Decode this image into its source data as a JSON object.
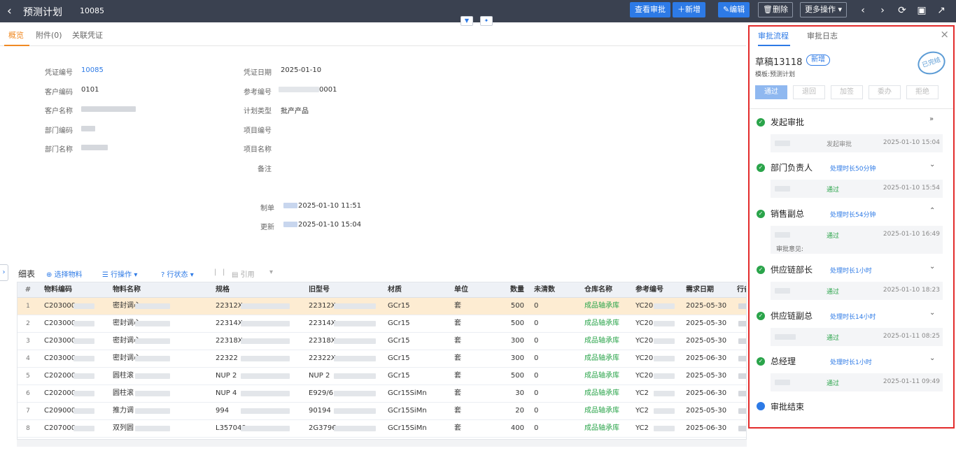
{
  "header": {
    "back_icon": "chevron-left-icon",
    "title": "预测计划",
    "number": "10085",
    "buttons": {
      "view_approval": "查看审批",
      "add": "新增",
      "edit": "编辑",
      "delete": "删除",
      "more": "更多操作"
    }
  },
  "tabs": [
    {
      "label": "概览"
    },
    {
      "label": "附件(0)"
    },
    {
      "label": "关联凭证"
    }
  ],
  "form": {
    "voucher_no_label": "凭证编号",
    "voucher_no": "10085",
    "customer_code_label": "客户编码",
    "customer_code": "0101",
    "customer_name_label": "客户名称",
    "dept_code_label": "部门编码",
    "dept_name_label": "部门名称",
    "voucher_date_label": "凭证日期",
    "voucher_date": "2025-01-10",
    "ref_no_label": "参考编号",
    "ref_no_tail": "0001",
    "plan_type_label": "计划类型",
    "plan_type": "批产产品",
    "project_code_label": "项目编号",
    "project_name_label": "项目名称",
    "remark_label": "备注",
    "creator_label": "制单",
    "creator_time": "2025-01-10 11:51",
    "updater_label": "更新",
    "updater_time": "2025-01-10 15:04"
  },
  "detail": {
    "title": "细表",
    "select_material": "选择物料",
    "row_ops": "行操作",
    "row_status": "行状态",
    "quote": "引用",
    "columns": [
      "#",
      "物料编码",
      "物料名称",
      "规格",
      "旧型号",
      "材质",
      "单位",
      "数量",
      "未清数",
      "仓库名称",
      "参考编号",
      "需求日期",
      "行备"
    ],
    "rows": [
      {
        "idx": "1",
        "code": "C203000",
        "name": "密封调心",
        "spec": "22312X",
        "old": "22312X",
        "material": "GCr15",
        "unit": "套",
        "qty": "500",
        "open": "0",
        "warehouse": "成品轴承库",
        "ref": "YC20",
        "date": "2025-05-30"
      },
      {
        "idx": "2",
        "code": "C203000",
        "name": "密封调心",
        "spec": "22314X",
        "old": "22314X",
        "material": "GCr15",
        "unit": "套",
        "qty": "500",
        "open": "0",
        "warehouse": "成品轴承库",
        "ref": "YC20",
        "date": "2025-05-30"
      },
      {
        "idx": "3",
        "code": "C203000",
        "name": "密封调心",
        "spec": "22318X",
        "old": "22318X",
        "material": "GCr15",
        "unit": "套",
        "qty": "300",
        "open": "0",
        "warehouse": "成品轴承库",
        "ref": "YC20",
        "date": "2025-05-30"
      },
      {
        "idx": "4",
        "code": "C203000",
        "name": "密封调心",
        "spec": "22322",
        "old": "22322X",
        "material": "GCr15",
        "unit": "套",
        "qty": "300",
        "open": "0",
        "warehouse": "成品轴承库",
        "ref": "YC20",
        "date": "2025-06-30"
      },
      {
        "idx": "5",
        "code": "C202000",
        "name": "圆柱滚",
        "spec": "NUP 2",
        "old": "NUP 2",
        "material": "GCr15",
        "unit": "套",
        "qty": "500",
        "open": "0",
        "warehouse": "成品轴承库",
        "ref": "YC20",
        "date": "2025-05-30"
      },
      {
        "idx": "6",
        "code": "C202000",
        "name": "圆柱滚",
        "spec": "NUP 4",
        "old": "E929/6",
        "material": "GCr15SiMn",
        "unit": "套",
        "qty": "30",
        "open": "0",
        "warehouse": "成品轴承库",
        "ref": "YC2",
        "date": "2025-06-30"
      },
      {
        "idx": "7",
        "code": "C209000",
        "name": "推力调",
        "spec": "994",
        "old": "90194",
        "material": "GCr15SiMn",
        "unit": "套",
        "qty": "20",
        "open": "0",
        "warehouse": "成品轴承库",
        "ref": "YC2",
        "date": "2025-05-30"
      },
      {
        "idx": "8",
        "code": "C207000",
        "name": "双列圆",
        "spec": "L357049",
        "old": "2G3796",
        "material": "GCr15SiMn",
        "unit": "套",
        "qty": "400",
        "open": "0",
        "warehouse": "成品轴承库",
        "ref": "YC2",
        "date": "2025-06-30"
      }
    ]
  },
  "panel": {
    "tab_flow": "审批流程",
    "tab_log": "审批日志",
    "draft": "草稿13118",
    "badge": "新增",
    "template": "模板:预测计划",
    "stamp": "已完结",
    "buttons": {
      "approve": "通过",
      "return": "退回",
      "add_sign": "加签",
      "delegate": "委办",
      "reject": "拒绝"
    },
    "steps": [
      {
        "title": "发起审批",
        "duration": "",
        "action": "发起审批",
        "time": "2025-01-10 15:04",
        "comment": ""
      },
      {
        "title": "部门负责人",
        "duration": "处理时长50分钟",
        "action": "通过",
        "time": "2025-01-10 15:54",
        "comment": ""
      },
      {
        "title": "销售副总",
        "duration": "处理时长54分钟",
        "action": "通过",
        "time": "2025-01-10 16:49",
        "comment": "审批意见:"
      },
      {
        "title": "供应链部长",
        "duration": "处理时长1小时",
        "action": "通过",
        "time": "2025-01-10 18:23",
        "comment": ""
      },
      {
        "title": "供应链副总",
        "duration": "处理时长14小时",
        "action": "通过",
        "time": "2025-01-11 08:25",
        "comment": ""
      },
      {
        "title": "总经理",
        "duration": "处理时长1小时",
        "action": "通过",
        "time": "2025-01-11 09:49",
        "comment": ""
      }
    ],
    "end": "审批结束"
  },
  "colors": {
    "accent": "#2d7ae6",
    "tab_active": "#f08a24",
    "success": "#2aa44a",
    "highlight": "#e32b2b"
  }
}
